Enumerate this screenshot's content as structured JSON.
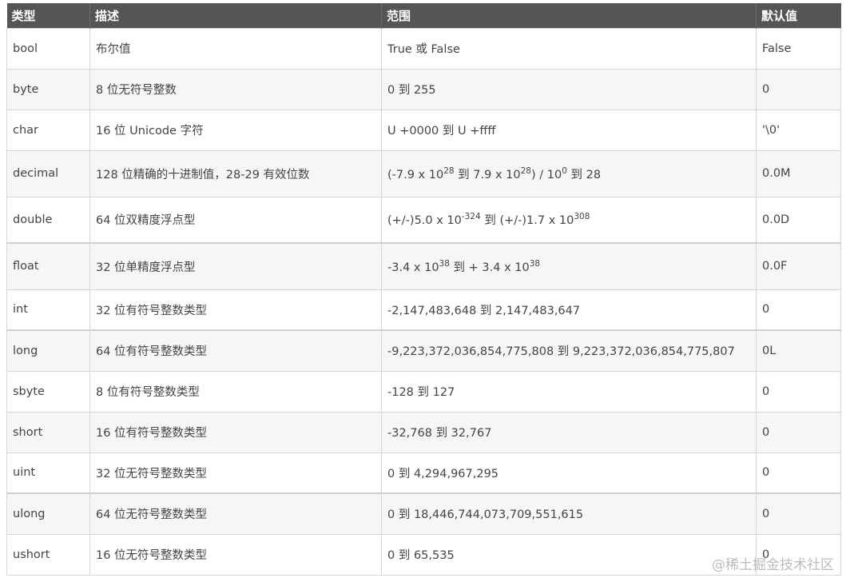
{
  "header": {
    "type": "类型",
    "desc": "描述",
    "range": "范围",
    "default": "默认值"
  },
  "rows": [
    {
      "type": "bool",
      "desc": "布尔值",
      "range": [
        "True 或 False"
      ],
      "default": "False"
    },
    {
      "type": "byte",
      "desc": "8 位无符号整数",
      "range": [
        "0 到 255"
      ],
      "default": "0"
    },
    {
      "type": "char",
      "desc": "16 位 Unicode 字符",
      "range": [
        "U +0000 到 U +ffff"
      ],
      "default": "'\\0'"
    },
    {
      "type": "decimal",
      "desc": "128 位精确的十进制值，28-29 有效位数",
      "range": [
        "(-7.9 x 10",
        "28",
        " 到 7.9 x 10",
        "28",
        ") / 10",
        "0",
        " 到 28"
      ],
      "default": "0.0M"
    },
    {
      "type": "double",
      "desc": "64 位双精度浮点型",
      "range": [
        "(+/-)5.0 x 10",
        "-324",
        " 到 (+/-)1.7 x 10",
        "308"
      ],
      "default": "0.0D"
    },
    {
      "type": "float",
      "desc": "32 位单精度浮点型",
      "range": [
        "-3.4 x 10",
        "38",
        " 到 + 3.4 x 10",
        "38"
      ],
      "default": "0.0F"
    },
    {
      "type": "int",
      "desc": "32 位有符号整数类型",
      "range": [
        "-2,147,483,648 到 2,147,483,647"
      ],
      "default": "0"
    },
    {
      "type": "long",
      "desc": "64 位有符号整数类型",
      "range": [
        "-9,223,372,036,854,775,808 到 9,223,372,036,854,775,807"
      ],
      "default": "0L"
    },
    {
      "type": "sbyte",
      "desc": "8 位有符号整数类型",
      "range": [
        "-128 到 127"
      ],
      "default": "0"
    },
    {
      "type": "short",
      "desc": "16 位有符号整数类型",
      "range": [
        "-32,768 到 32,767"
      ],
      "default": "0"
    },
    {
      "type": "uint",
      "desc": "32 位无符号整数类型",
      "range": [
        "0 到 4,294,967,295"
      ],
      "default": "0"
    },
    {
      "type": "ulong",
      "desc": "64 位无符号整数类型",
      "range": [
        "0 到 18,446,744,073,709,551,615"
      ],
      "default": "0"
    },
    {
      "type": "ushort",
      "desc": "16 位无符号整数类型",
      "range": [
        "0 到 65,535"
      ],
      "default": "0"
    }
  ],
  "watermark": "@稀土掘金技术社区"
}
